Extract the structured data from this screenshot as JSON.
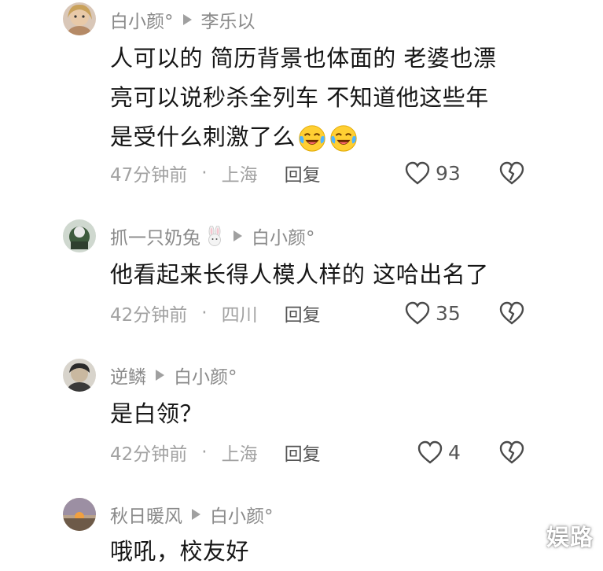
{
  "comments": [
    {
      "author": "白小颜°",
      "reply_to": "李乐以",
      "text_lines": [
        "人可以的 简历背景也体面的 老婆也漂",
        "亮可以说秒杀全列车 不知道他这些年",
        "是受什么刺激了么"
      ],
      "time": "47分钟前",
      "location": "上海",
      "reply_label": "回复",
      "likes": "93"
    },
    {
      "author": "抓一只奶兔",
      "reply_to": "白小颜°",
      "text_lines": [
        "他看起来长得人模人样的 这哈出名了"
      ],
      "time": "42分钟前",
      "location": "四川",
      "reply_label": "回复",
      "likes": "35"
    },
    {
      "author": "逆鳞",
      "reply_to": "白小颜°",
      "text_lines": [
        "是白领？"
      ],
      "time": "42分钟前",
      "location": "上海",
      "reply_label": "回复",
      "likes": "4"
    },
    {
      "author": "秋日暖风",
      "reply_to": "白小颜°",
      "text_lines": [
        "哦吼，校友好"
      ]
    }
  ],
  "separator": "·",
  "watermark": "娱路",
  "icons": {
    "emoji": "crying-laughing-emoji",
    "like": "heart-outline-icon",
    "dislike": "broken-heart-icon",
    "arrow": "play-triangle-icon",
    "rabbit": "rabbit-emoji"
  },
  "colors": {
    "meta_gray": "#a2a2a2",
    "header_gray": "#8a8a8a",
    "text": "#161616"
  }
}
